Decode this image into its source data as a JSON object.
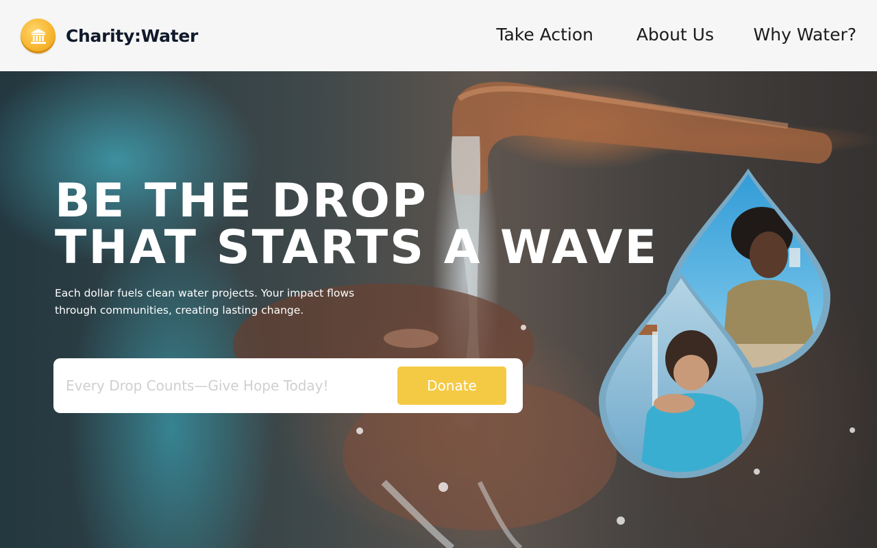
{
  "header": {
    "brand": "Charity:Water",
    "logo_icon": "bank-icon",
    "nav": [
      {
        "label": "Take Action"
      },
      {
        "label": "About Us"
      },
      {
        "label": "Why Water?"
      }
    ]
  },
  "hero": {
    "headline_line1": "BE THE DROP",
    "headline_line2": "THAT STARTS A WAVE",
    "subtext": "Each dollar fuels clean water projects. Your impact flows through communities, creating lasting change.",
    "donate_placeholder": "Every Drop Counts—Give Hope Today!",
    "donate_value": "",
    "donate_button": "Donate"
  },
  "colors": {
    "accent_yellow": "#f4ca45",
    "drop_border": "#7aa9c4",
    "brand_dark": "#111a2b"
  }
}
